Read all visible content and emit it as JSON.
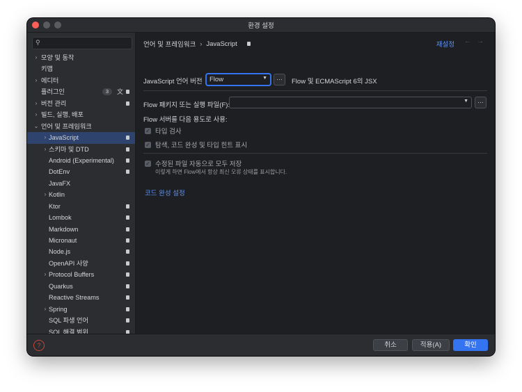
{
  "window": {
    "title": "환경 설정"
  },
  "search": {
    "placeholder": ""
  },
  "sidebar": {
    "plugins_count": "3",
    "items": [
      {
        "label": "모양 및 동작",
        "indent": 0,
        "arrow": "›",
        "lock": false
      },
      {
        "label": "키맵",
        "indent": 0,
        "arrow": "",
        "lock": false
      },
      {
        "label": "에디터",
        "indent": 0,
        "arrow": "›",
        "lock": false
      },
      {
        "label": "플러그인",
        "indent": 0,
        "arrow": "",
        "lock": true,
        "count": true
      },
      {
        "label": "버전 관리",
        "indent": 0,
        "arrow": "›",
        "lock": true
      },
      {
        "label": "빌드, 실행, 배포",
        "indent": 0,
        "arrow": "›",
        "lock": false
      },
      {
        "label": "언어 및 프레임워크",
        "indent": 0,
        "arrow": "⌄",
        "lock": false
      },
      {
        "label": "JavaScript",
        "indent": 1,
        "arrow": "›",
        "lock": true,
        "selected": true
      },
      {
        "label": "스키마 및 DTD",
        "indent": 1,
        "arrow": "›",
        "lock": true
      },
      {
        "label": "Android (Experimental)",
        "indent": 1,
        "arrow": "",
        "lock": true
      },
      {
        "label": "DotEnv",
        "indent": 1,
        "arrow": "",
        "lock": true
      },
      {
        "label": "JavaFX",
        "indent": 1,
        "arrow": "",
        "lock": false
      },
      {
        "label": "Kotlin",
        "indent": 1,
        "arrow": "›",
        "lock": false
      },
      {
        "label": "Ktor",
        "indent": 1,
        "arrow": "",
        "lock": true
      },
      {
        "label": "Lombok",
        "indent": 1,
        "arrow": "",
        "lock": true
      },
      {
        "label": "Markdown",
        "indent": 1,
        "arrow": "",
        "lock": true
      },
      {
        "label": "Micronaut",
        "indent": 1,
        "arrow": "",
        "lock": true
      },
      {
        "label": "Node.js",
        "indent": 1,
        "arrow": "",
        "lock": true
      },
      {
        "label": "OpenAPI 사양",
        "indent": 1,
        "arrow": "",
        "lock": true
      },
      {
        "label": "Protocol Buffers",
        "indent": 1,
        "arrow": "›",
        "lock": true
      },
      {
        "label": "Quarkus",
        "indent": 1,
        "arrow": "",
        "lock": true
      },
      {
        "label": "Reactive Streams",
        "indent": 1,
        "arrow": "",
        "lock": true
      },
      {
        "label": "Spring",
        "indent": 1,
        "arrow": "›",
        "lock": true
      },
      {
        "label": "SQL 파생 언어",
        "indent": 1,
        "arrow": "",
        "lock": true
      },
      {
        "label": "SQL 해결 범위",
        "indent": 1,
        "arrow": "",
        "lock": true
      }
    ]
  },
  "header": {
    "crumb_parent": "언어 및 프레임워크",
    "crumb_sep": "›",
    "crumb_current": "JavaScript",
    "reset": "재설정"
  },
  "js_version": {
    "label": "JavaScript 언어 버전",
    "value": "Flow",
    "description": "Flow 및 ECMAScript 6의 JSX"
  },
  "flow_package": {
    "label": "Flow 패키지 또는 실행 파일(F):",
    "value": ""
  },
  "flow_server": {
    "label": "Flow 서버를 다음 용도로 사용:",
    "type_check": "타입 검사",
    "navigation": "탐색, 코드 완성 및 타입 힌트 표시"
  },
  "autosave": {
    "label": "수정된 파일 자동으로 모두 저장",
    "hint": "이렇게 하면 Flow에서 항상 최신 오류 상태를 표시합니다."
  },
  "code_completion_link": "코드 완성 설정",
  "buttons": {
    "cancel": "취소",
    "apply": "적용(A)",
    "ok": "확인",
    "ellipsis": "…"
  },
  "icons": {
    "search": "search-icon",
    "help": "help-icon",
    "lock": "lock-icon",
    "back": "arrow-left-icon",
    "forward": "arrow-right-icon",
    "translate": "translate-icon"
  }
}
